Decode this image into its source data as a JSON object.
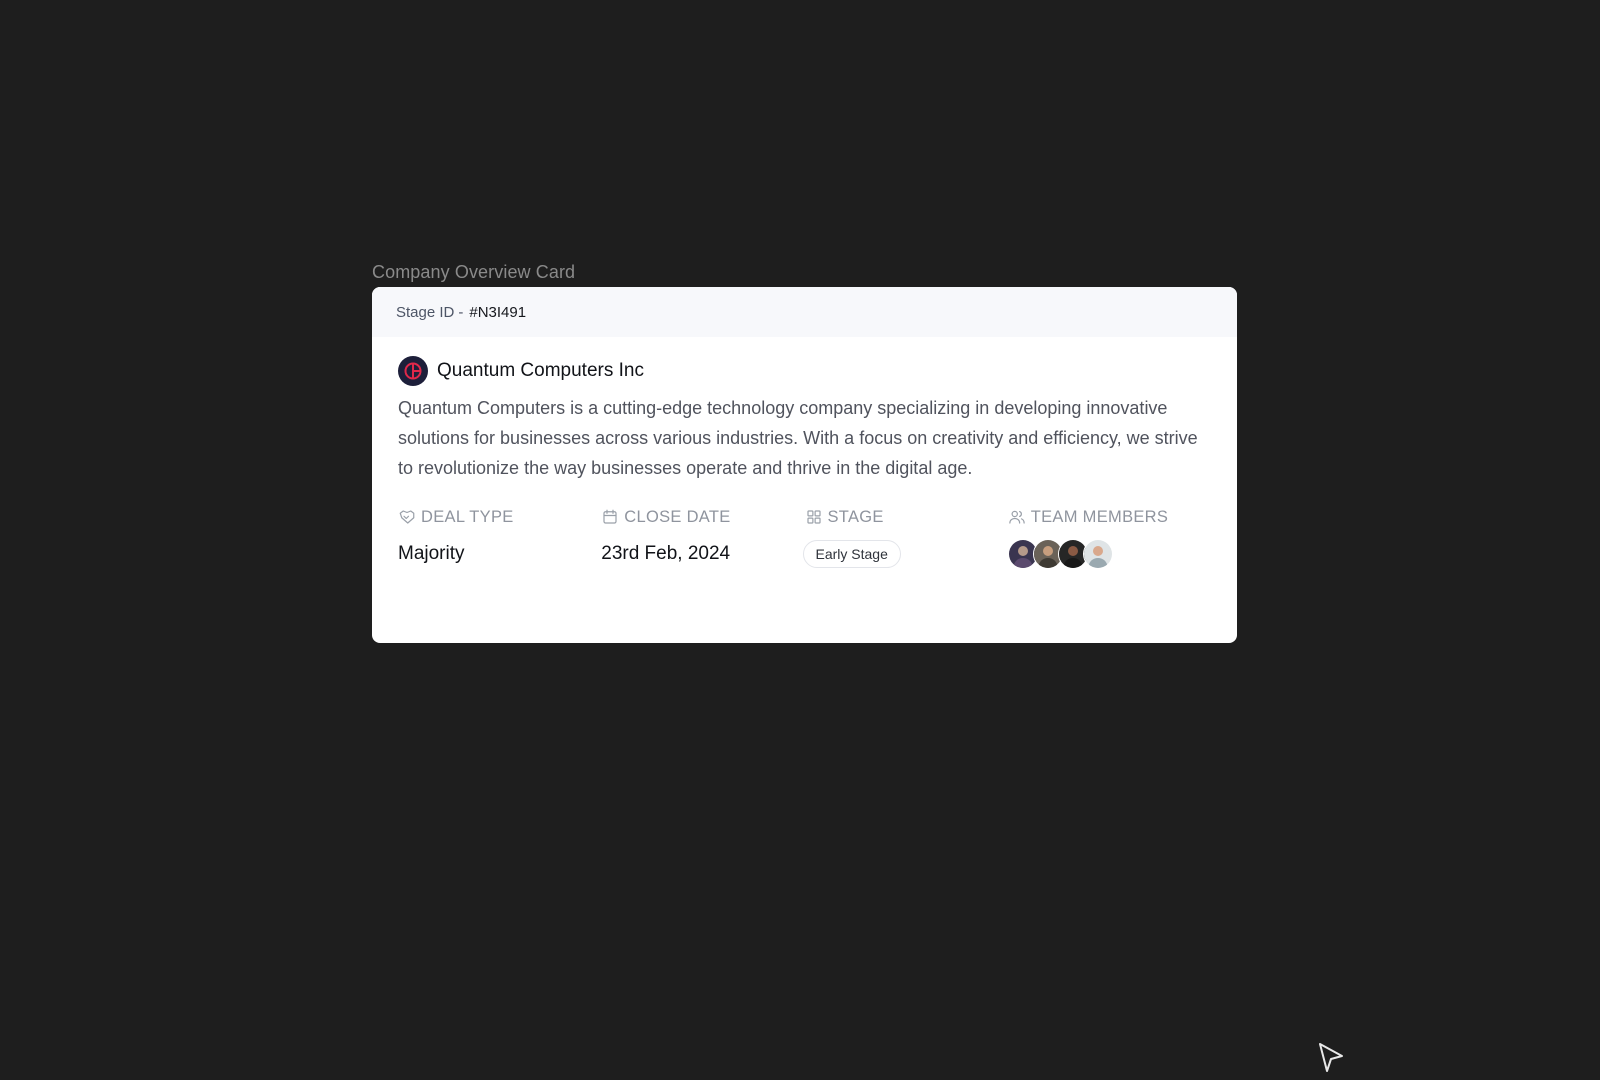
{
  "frame": {
    "label": "Company Overview Card"
  },
  "card": {
    "header": {
      "stage_id_label": "Stage ID",
      "stage_id_separator": "-",
      "stage_id_value": "#N3I491"
    },
    "company": {
      "logo_icon": "company-logo-icon",
      "name": "Quantum Computers Inc",
      "description": "Quantum Computers is a cutting-edge technology company specializing in developing innovative solutions for businesses across various industries. With a focus on creativity and efficiency, we strive to revolutionize the way businesses operate and thrive in the digital age."
    },
    "meta": {
      "deal_type": {
        "icon": "handshake-icon",
        "label": "DEAL TYPE",
        "value": "Majority"
      },
      "close_date": {
        "icon": "calendar-icon",
        "label": "CLOSE DATE",
        "value": "23rd Feb, 2024"
      },
      "stage": {
        "icon": "grid-icon",
        "label": "STAGE",
        "value": "Early Stage"
      },
      "team_members": {
        "icon": "users-icon",
        "label": "TEAM MEMBERS",
        "count": 4
      }
    }
  },
  "colors": {
    "background": "#1e1e1e",
    "card": "#ffffff",
    "header_bg": "#f7f8fb",
    "logo_bg": "#1d1f3a",
    "logo_accent": "#e0284a",
    "muted_text": "#8f949e"
  }
}
